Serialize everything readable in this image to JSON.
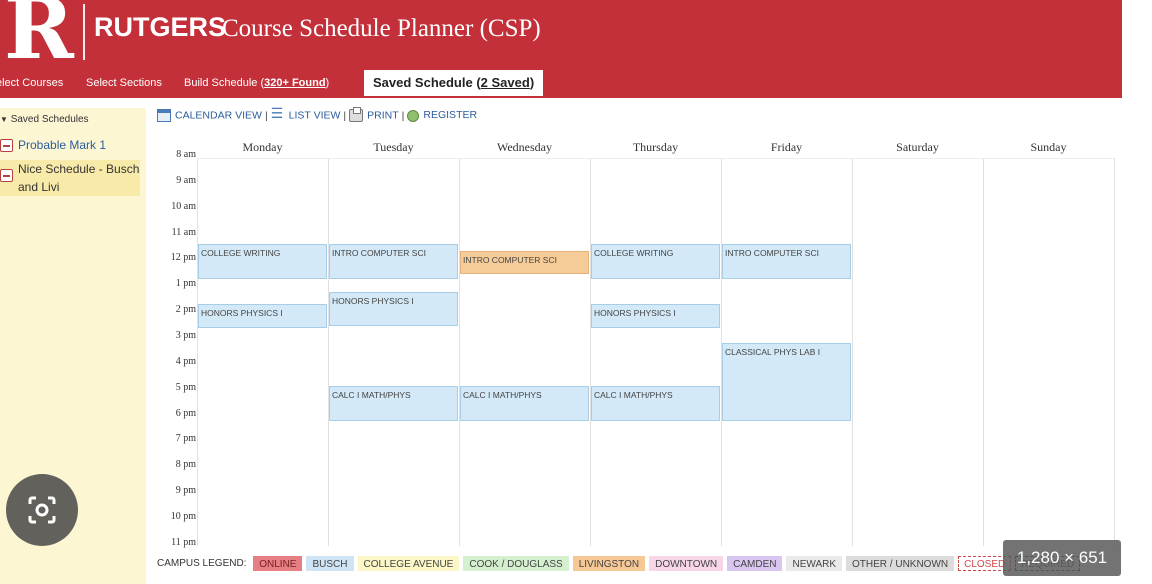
{
  "header": {
    "brand": "RUTGERS",
    "title": "Course Schedule Planner (CSP)"
  },
  "tabs": [
    {
      "label": "elect Courses"
    },
    {
      "label": "Select Sections"
    },
    {
      "label_prefix": "Build Schedule (",
      "label_link": "320+ Found",
      "label_suffix": ")"
    },
    {
      "label_prefix": "Saved Schedule (",
      "label_link": "2 Saved",
      "label_suffix": ")"
    }
  ],
  "sidebar": {
    "title": "Saved Schedules",
    "items": [
      {
        "label": "Probable Mark 1"
      },
      {
        "label": "Nice Schedule - Busch and Livi"
      }
    ]
  },
  "toolbar": {
    "calendar": "CALENDAR VIEW",
    "list": "LIST VIEW",
    "print": "PRINT",
    "register": "REGISTER"
  },
  "days": [
    "Monday",
    "Tuesday",
    "Wednesday",
    "Thursday",
    "Friday",
    "Saturday",
    "Sunday"
  ],
  "times": [
    "8 am",
    "9 am",
    "10 am",
    "11 am",
    "12 pm",
    "1 pm",
    "2 pm",
    "3 pm",
    "4 pm",
    "5 pm",
    "6 pm",
    "7 pm",
    "8 pm",
    "9 pm",
    "10 pm",
    "11 pm"
  ],
  "events": [
    {
      "title": "COLLEGE WRITING",
      "day": 0,
      "start": "11:20",
      "end": "12:40",
      "campus": "busch"
    },
    {
      "title": "HONORS PHYSICS I",
      "day": 0,
      "start": "1:40",
      "end": "2:35",
      "campus": "busch"
    },
    {
      "title": "INTRO COMPUTER SCI",
      "day": 1,
      "start": "11:20",
      "end": "12:40",
      "campus": "busch"
    },
    {
      "title": "HONORS PHYSICS I",
      "day": 1,
      "start": "1:10",
      "end": "2:30",
      "campus": "busch"
    },
    {
      "title": "CALC I MATH/PHYS",
      "day": 1,
      "start": "4:50",
      "end": "6:10",
      "campus": "busch"
    },
    {
      "title": "INTRO COMPUTER SCI",
      "day": 2,
      "start": "11:35",
      "end": "12:30",
      "campus": "livingston"
    },
    {
      "title": "CALC I MATH/PHYS",
      "day": 2,
      "start": "4:50",
      "end": "6:10",
      "campus": "busch"
    },
    {
      "title": "COLLEGE WRITING",
      "day": 3,
      "start": "11:20",
      "end": "12:40",
      "campus": "busch"
    },
    {
      "title": "HONORS PHYSICS I",
      "day": 3,
      "start": "1:40",
      "end": "2:35",
      "campus": "busch"
    },
    {
      "title": "CALC I MATH/PHYS",
      "day": 3,
      "start": "4:50",
      "end": "6:10",
      "campus": "busch"
    },
    {
      "title": "INTRO COMPUTER SCI",
      "day": 4,
      "start": "11:20",
      "end": "12:40",
      "campus": "busch"
    },
    {
      "title": "CLASSICAL PHYS LAB I",
      "day": 4,
      "start": "3:10",
      "end": "6:10",
      "campus": "busch"
    }
  ],
  "legend": {
    "label": "CAMPUS LEGEND:",
    "items": [
      {
        "label": "ONLINE",
        "bg": "#e57f84",
        "border": "#e57f84",
        "color": "#7a2126"
      },
      {
        "label": "BUSCH",
        "bg": "#cfe4f4",
        "border": "#cfe4f4",
        "color": "#444444"
      },
      {
        "label": "COLLEGE AVENUE",
        "bg": "#fbf7c6",
        "border": "#fbf7c6",
        "color": "#444444"
      },
      {
        "label": "COOK / DOUGLASS",
        "bg": "#d4f0cf",
        "border": "#d4f0cf",
        "color": "#444444"
      },
      {
        "label": "LIVINGSTON",
        "bg": "#f6c894",
        "border": "#f6c894",
        "color": "#444444"
      },
      {
        "label": "DOWNTOWN",
        "bg": "#f7d6e8",
        "border": "#f7d6e8",
        "color": "#444444"
      },
      {
        "label": "CAMDEN",
        "bg": "#d8c6f0",
        "border": "#d8c6f0",
        "color": "#444444"
      },
      {
        "label": "NEWARK",
        "bg": "#eaeaea",
        "border": "#eaeaea",
        "color": "#444444"
      },
      {
        "label": "OTHER / UNKNOWN",
        "bg": "#dcdcdc",
        "border": "#dcdcdc",
        "color": "#444444"
      },
      {
        "label": "CLOSED",
        "bg": "#ffffff",
        "border": "#d04848",
        "color": "#d04848"
      },
      {
        "label": "REQUIRED",
        "bg": "#ffffff",
        "border": "#333333",
        "color": "#444444"
      }
    ]
  },
  "overlay": {
    "dimensions": "1,280 × 651"
  },
  "colors": {
    "brand_red": "#c4303a",
    "busch": "#d3e9f7",
    "livingston": "#f5cc98",
    "sidebar_bg": "#fdf6d3"
  }
}
